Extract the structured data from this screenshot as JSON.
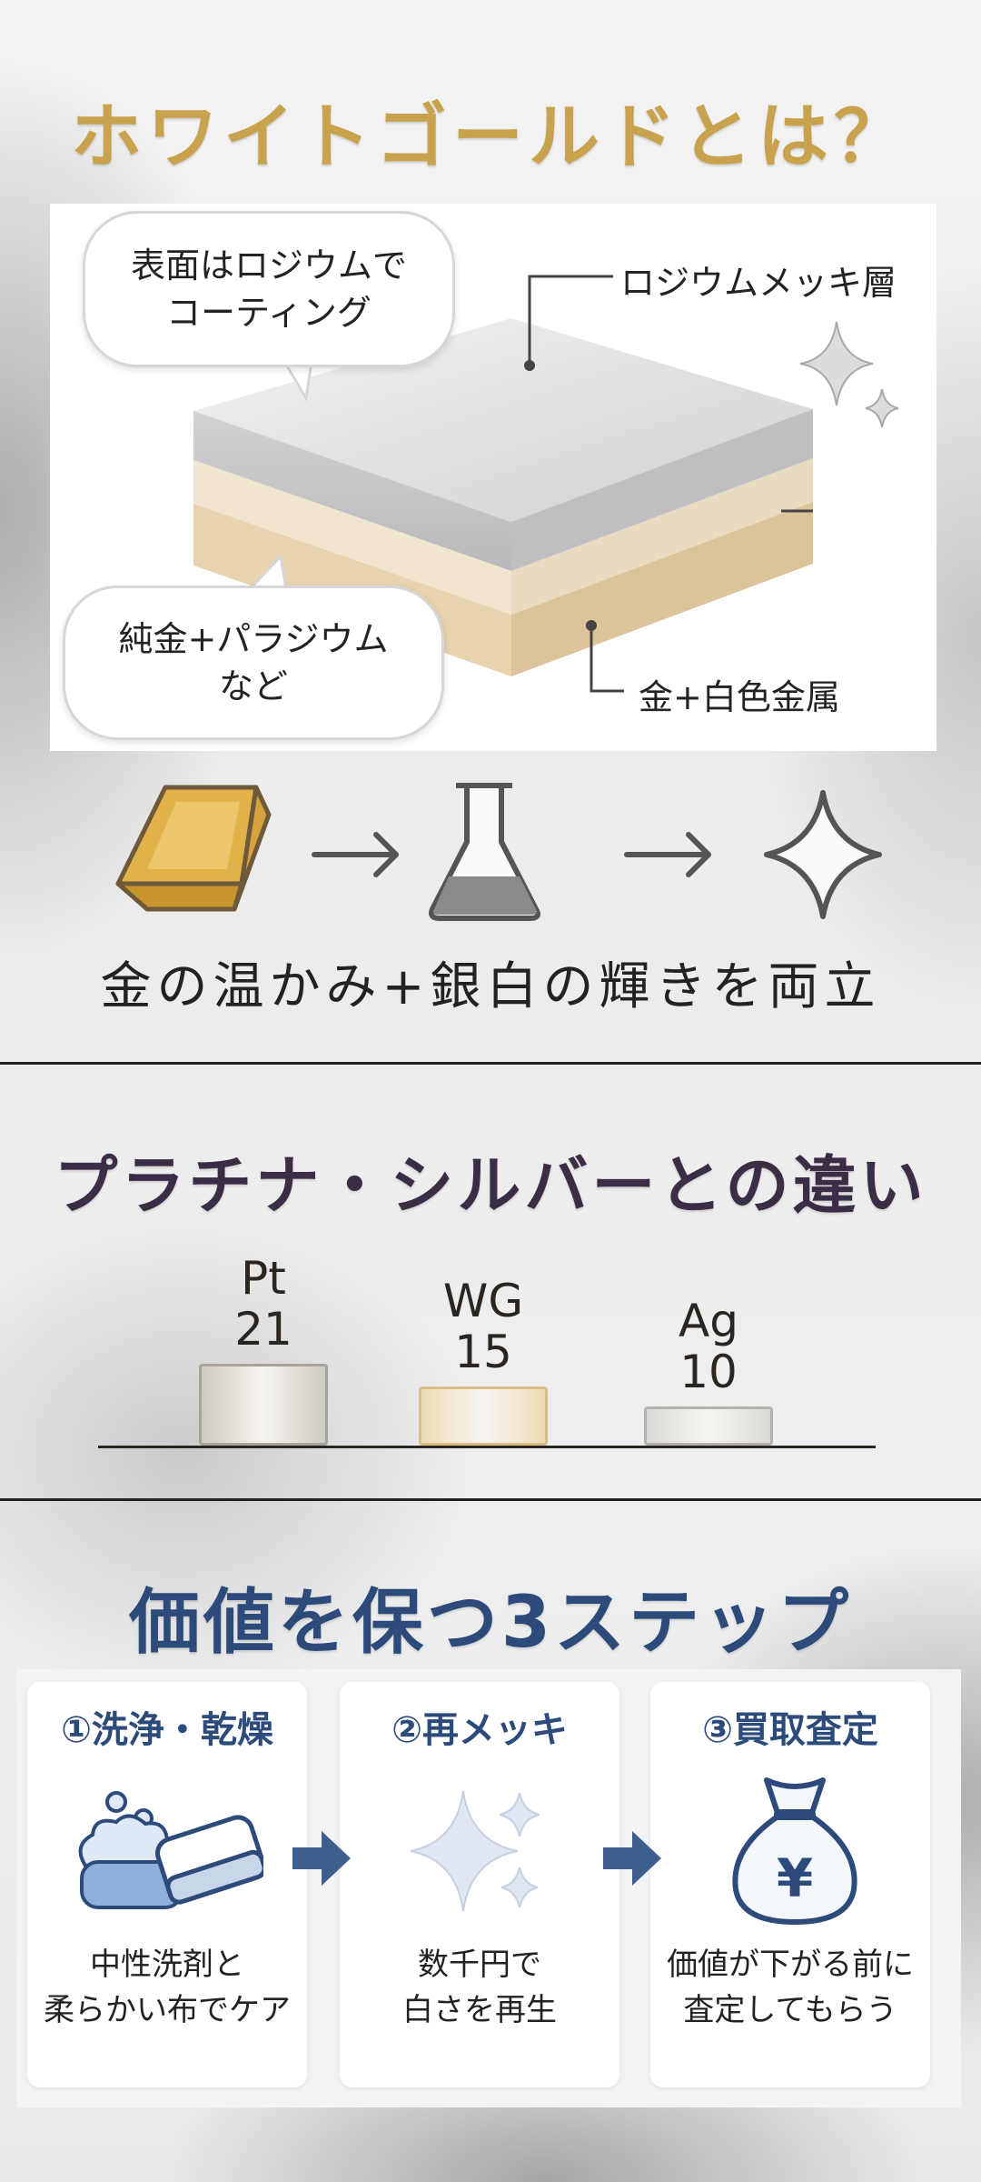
{
  "section1": {
    "title": "ホワイトゴールドとは？",
    "bubble_top": [
      "表面はロジウムで",
      "コーティング"
    ],
    "bubble_bottom": [
      "純金+パラジウム",
      "など"
    ],
    "label_top": "ロジウムメッキ層",
    "label_bottom": "金+白色金属",
    "flow_caption": "金の温かみ+銀白の輝きを両立",
    "flow_icons": [
      "gold-bar-icon",
      "arrow-right-icon",
      "flask-icon",
      "arrow-right-icon",
      "sparkle-icon"
    ]
  },
  "section2": {
    "title": "プラチナ・シルバーとの違い",
    "chart_data": {
      "type": "bar",
      "categories": [
        "Pt",
        "WG",
        "Ag"
      ],
      "values": [
        21,
        15,
        10
      ],
      "colors": [
        "#cfcac0",
        "#efdcb5",
        "#dcdad6"
      ],
      "title": "",
      "xlabel": "",
      "ylabel": ""
    }
  },
  "section3": {
    "title": "価値を保つ3ステップ",
    "steps": [
      {
        "title": "①洗浄・乾燥",
        "icon": "sponge-bubbles-icon",
        "desc": [
          "中性洗剤と",
          "柔らかい布でケア"
        ]
      },
      {
        "title": "②再メッキ",
        "icon": "sparkle-icon",
        "desc": [
          "数千円で",
          "白さを再生"
        ]
      },
      {
        "title": "③買取査定",
        "icon": "money-bag-yen-icon",
        "desc": [
          "価値が下がる前に",
          "査定してもらう"
        ]
      }
    ],
    "accent": "#2c4a7a"
  }
}
